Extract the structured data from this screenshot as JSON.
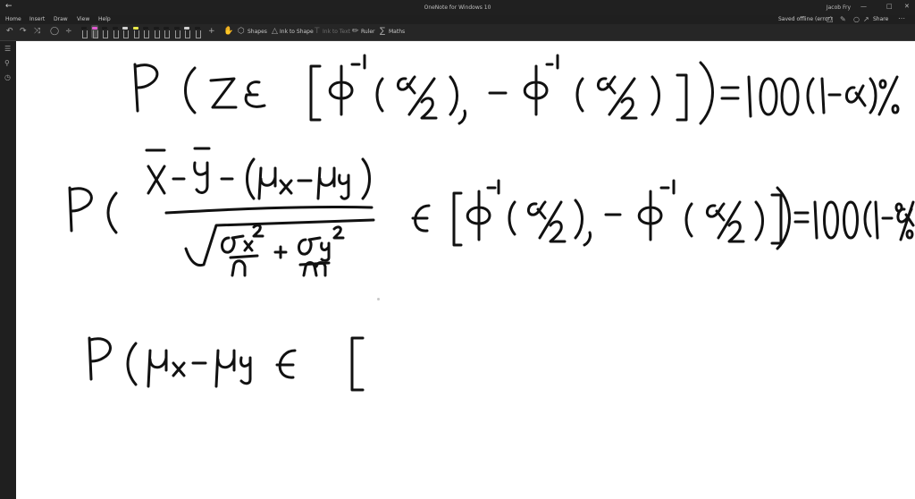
{
  "app": {
    "title": "OneNote for Windows 10",
    "user": "Jacob Fry",
    "sync_status": "Saved offline (error)",
    "share_label": "Share"
  },
  "tabs": [
    "Home",
    "Insert",
    "Draw",
    "View",
    "Help"
  ],
  "ribbon": {
    "shapes_label": "Shapes",
    "ink_to_shape_label": "Ink to Shape",
    "ink_to_text_label": "Ink to Text",
    "ruler_label": "Ruler",
    "maths_label": "Maths"
  },
  "pens": [
    {
      "color": "#1a1a1a"
    },
    {
      "color": "#e05ad0"
    },
    {
      "color": "#1a1a1a"
    },
    {
      "color": "#1a1a1a"
    },
    {
      "color": "#d0d0d0"
    },
    {
      "color": "#e8e84a"
    },
    {
      "color": "#1a1a1a"
    },
    {
      "color": "#1a1a1a"
    },
    {
      "color": "#1a1a1a"
    },
    {
      "color": "#1a1a1a"
    },
    {
      "color": "#d0d0d0"
    },
    {
      "color": "#1a1a1a"
    }
  ],
  "colors": {
    "accent_pen": "#e05ad0",
    "highlighter": "#e8e84a",
    "ink": "#111111"
  }
}
